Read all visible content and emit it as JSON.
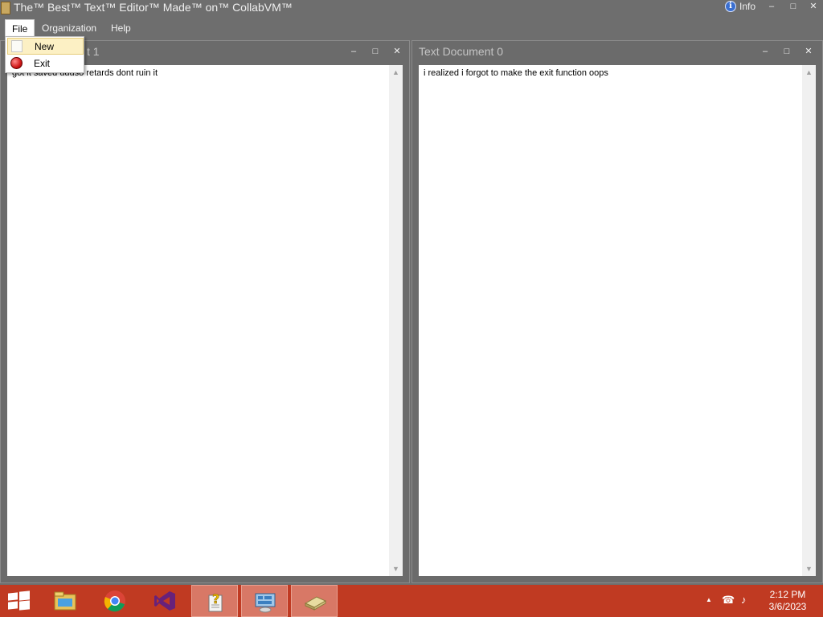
{
  "app": {
    "title": "The™ Best™ Text™ Editor™ Made™ on™ CollabVM™",
    "info_label": "Info",
    "info_icon": "i"
  },
  "window_controls": {
    "minimize": "–",
    "maximize": "□",
    "close": "✕"
  },
  "menu": {
    "items": [
      {
        "label": "File"
      },
      {
        "label": "Organization"
      },
      {
        "label": "Help"
      }
    ]
  },
  "file_dropdown": {
    "items": [
      {
        "label": "New",
        "icon": "new-document-icon"
      },
      {
        "label": "Exit",
        "icon": "exit-icon"
      }
    ]
  },
  "documents": [
    {
      "title_visible": "t 1",
      "text_visible": "got it saved uuuso retards dont ruin it"
    },
    {
      "title": "Text Document 0",
      "text": "i realized i forgot to make the exit function oops"
    }
  ],
  "scroll": {
    "up": "▲",
    "down": "▼"
  },
  "taskbar": {
    "apps": [
      "windows-start",
      "file-explorer",
      "chrome",
      "visual-studio",
      "help-app",
      "network-app",
      "text-editor-app"
    ],
    "tray_up": "▲",
    "tray_network": "☎",
    "tray_volume": "♪",
    "time": "2:12 PM",
    "date": "3/6/2023"
  },
  "colors": {
    "desktop": "#6e6e6e",
    "taskbar": "#c03a22",
    "menu_hover": "#fcf0c4"
  }
}
